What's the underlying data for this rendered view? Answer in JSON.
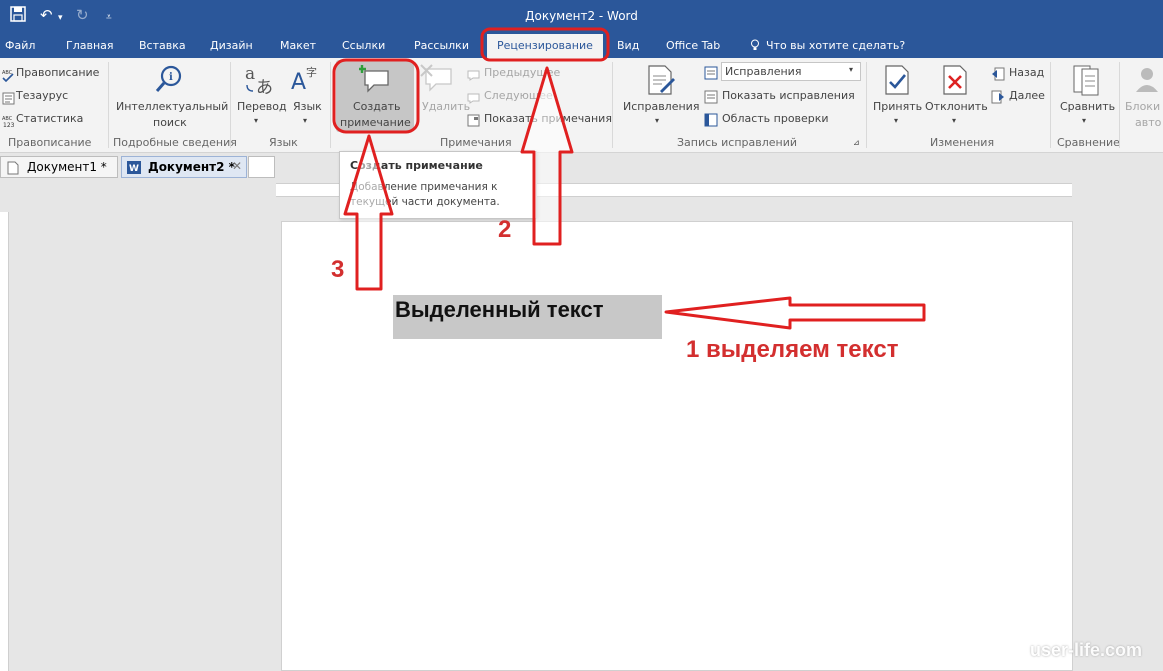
{
  "window": {
    "title": "Документ2 - Word"
  },
  "ribbon_tabs": {
    "file": "Файл",
    "home": "Главная",
    "insert": "Вставка",
    "design": "Дизайн",
    "layout": "Макет",
    "references": "Ссылки",
    "mailings": "Рассылки",
    "review": "Рецензирование",
    "view": "Вид",
    "office_tab": "Office Tab",
    "tell_me": "Что вы хотите сделать?"
  },
  "ribbon": {
    "proofing": {
      "spelling": "Правописание",
      "thesaurus": "Тезаурус",
      "stats": "Статистика",
      "label": "Правописание"
    },
    "insights": {
      "smart_lookup_line1": "Интеллектуальный",
      "smart_lookup_line2": "поиск",
      "label": "Подробные сведения"
    },
    "language": {
      "translate": "Перевод",
      "language": "Язык",
      "label": "Язык"
    },
    "comments": {
      "new_comment_line1": "Создать",
      "new_comment_line2": "примечание",
      "delete": "Удалить",
      "previous": "Предыдущее",
      "next": "Следующее",
      "show_comments": "Показать примечания",
      "label": "Примечания"
    },
    "tracking": {
      "track_changes": "Исправления",
      "display_mode": "Исправления",
      "show_markup": "Показать исправления",
      "reviewing_pane": "Область проверки",
      "label": "Запись исправлений"
    },
    "changes": {
      "accept": "Принять",
      "reject": "Отклонить",
      "previous": "Назад",
      "next": "Далее",
      "label": "Изменения"
    },
    "compare": {
      "compare": "Сравнить",
      "label": "Сравнение"
    },
    "protect": {
      "block_line1": "Блоки",
      "block_line2": "авто"
    }
  },
  "doc_tabs": [
    {
      "label": "Документ1 *"
    },
    {
      "label": "Документ2 *"
    }
  ],
  "tooltip": {
    "title": "Создать примечание",
    "description": "Добавление примечания к текущей части документа."
  },
  "document": {
    "selected_text": "Выделенный текст"
  },
  "annotations": {
    "step1": "1 выделяем текст",
    "step2": "2",
    "step3": "3",
    "color": "#d32f2f"
  },
  "watermark": "user-life.com",
  "colors": {
    "titlebar": "#2b579a",
    "ribbon": "#f3f3f3",
    "accent_red": "#e02020"
  }
}
